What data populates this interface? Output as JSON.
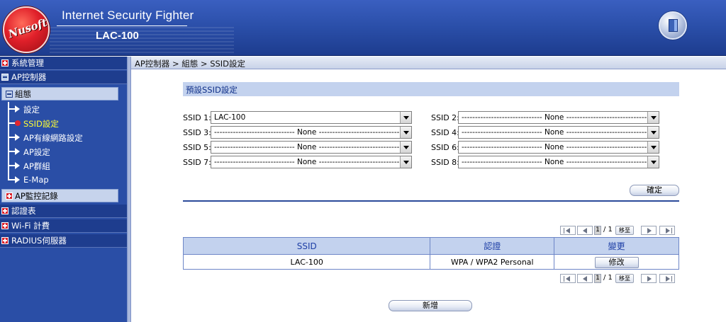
{
  "header": {
    "logo_text": "Nusoft",
    "app_title": "Internet Security Fighter",
    "model": "LAC-100"
  },
  "sidebar": {
    "items": [
      {
        "label": "系統管理"
      },
      {
        "label": "AP控制器"
      },
      {
        "label": "組態"
      },
      {
        "label": "設定"
      },
      {
        "label": "SSID設定"
      },
      {
        "label": "AP有線網路設定"
      },
      {
        "label": "AP設定"
      },
      {
        "label": "AP群組"
      },
      {
        "label": "E-Map"
      },
      {
        "label": "AP監控記錄"
      },
      {
        "label": "認證表"
      },
      {
        "label": "Wi-Fi 計費"
      },
      {
        "label": "RADIUS伺服器"
      }
    ],
    "active_color": "#ffff33"
  },
  "breadcrumb": "AP控制器 > 組態 > SSID設定",
  "section": {
    "title": "預設SSID設定"
  },
  "ssid_slots": [
    {
      "label": "SSID 1:",
      "value": "LAC-100"
    },
    {
      "label": "SSID 2:",
      "value": "------------------------------ None ------------------------------"
    },
    {
      "label": "SSID 3:",
      "value": "------------------------------ None ------------------------------"
    },
    {
      "label": "SSID 4:",
      "value": "------------------------------ None ------------------------------"
    },
    {
      "label": "SSID 5:",
      "value": "------------------------------ None ------------------------------"
    },
    {
      "label": "SSID 6:",
      "value": "------------------------------ None ------------------------------"
    },
    {
      "label": "SSID 7:",
      "value": "------------------------------ None ------------------------------"
    },
    {
      "label": "SSID 8:",
      "value": "------------------------------ None ------------------------------"
    }
  ],
  "confirm_label": "確定",
  "pager": {
    "page": "1",
    "total": "/ 1",
    "go_label": "移至"
  },
  "table": {
    "columns": [
      "SSID",
      "認證",
      "變更"
    ],
    "rows": [
      {
        "ssid": "LAC-100",
        "auth": "WPA / WPA2 Personal",
        "action": "修改"
      }
    ]
  },
  "add_label": "新增",
  "colors": {
    "header_bg": "#2a4ea8",
    "sidebar_bg": "#2a4ea6",
    "section_bg": "#c3d2ee",
    "accent": "#2b4a9a"
  },
  "icons": [
    "logo",
    "logout-door-icon",
    "plus-icon",
    "minus-icon",
    "arrow-icon",
    "dot-icon",
    "dropdown-arrow-icon",
    "first-page-icon",
    "prev-page-icon",
    "next-page-icon",
    "last-page-icon"
  ]
}
